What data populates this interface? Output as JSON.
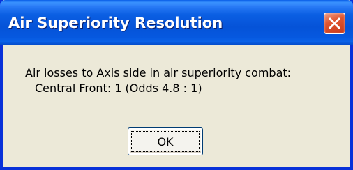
{
  "window": {
    "title": "Air Superiority Resolution",
    "close_icon": "close-icon",
    "accent_color": "#0831d9",
    "close_color": "#e0552f"
  },
  "message": {
    "line1": "Air losses to Axis side in air superiority combat:",
    "line2": "Central Front: 1 (Odds 4.8 : 1)"
  },
  "buttons": {
    "ok_label": "OK"
  }
}
